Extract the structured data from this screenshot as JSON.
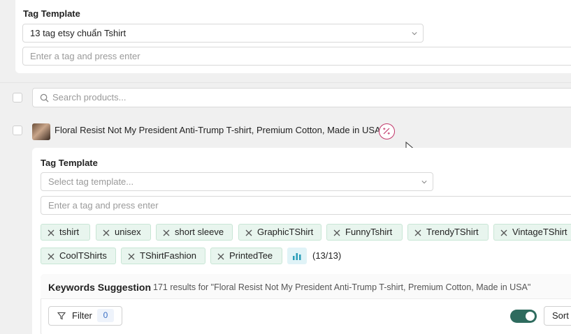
{
  "top_template": {
    "label": "Tag Template",
    "selected_template": "13 tag etsy chuẩn Tshirt",
    "tag_input_placeholder": "Enter a tag and press enter"
  },
  "search": {
    "placeholder": "Search products..."
  },
  "product": {
    "title": "Floral Resist Not My President Anti-Trump T-shirt, Premium Cotton, Made in USA",
    "tag_template": {
      "label": "Tag Template",
      "select_placeholder": "Select tag template...",
      "tag_input_placeholder": "Enter a tag and press enter"
    },
    "tags": [
      "tshirt",
      "unisex",
      "short sleeve",
      "GraphicTShirt",
      "FunnyTshirt",
      "TrendyTShirt",
      "VintageTShirt",
      "CoolTShirts",
      "TShirtFashion",
      "PrintedTee"
    ],
    "tag_count": "(13/13)"
  },
  "keywords": {
    "title": "Keywords Suggestion",
    "results_text": "171 results for  \"Floral Resist Not My President Anti-Trump T-shirt, Premium Cotton, Made in USA\"",
    "filter_label": "Filter",
    "filter_count": "0",
    "sort_label": "Sort"
  },
  "colors": {
    "tag_bg": "#e8f5ee",
    "toggle_on": "#2e6b5e",
    "magic_accent": "#c2376a"
  },
  "icons": {
    "chevron": "chevron-down-icon",
    "search": "search-icon",
    "remove_tag": "close-icon",
    "magic": "magic-wand-icon",
    "chart": "bar-chart-icon",
    "filter": "funnel-icon"
  }
}
